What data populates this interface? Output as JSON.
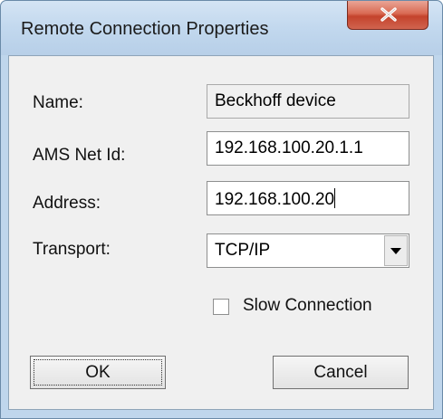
{
  "window": {
    "title": "Remote Connection Properties",
    "close_icon": "close-x-icon"
  },
  "form": {
    "name_label": "Name:",
    "name_value": "Beckhoff device",
    "ams_label": "AMS Net Id:",
    "ams_value": "192.168.100.20.1.1",
    "address_label": "Address:",
    "address_value": "192.168.100.20",
    "transport_label": "Transport:",
    "transport_value": "TCP/IP",
    "dropdown_icon": "chevron-down-icon",
    "slow_connection_label": "Slow Connection",
    "slow_connection_checked": false
  },
  "buttons": {
    "ok_label": "OK",
    "cancel_label": "Cancel"
  },
  "colors": {
    "frame": "#bfd6ec",
    "client": "#f0f0f0",
    "close_button": "#c4432c"
  }
}
